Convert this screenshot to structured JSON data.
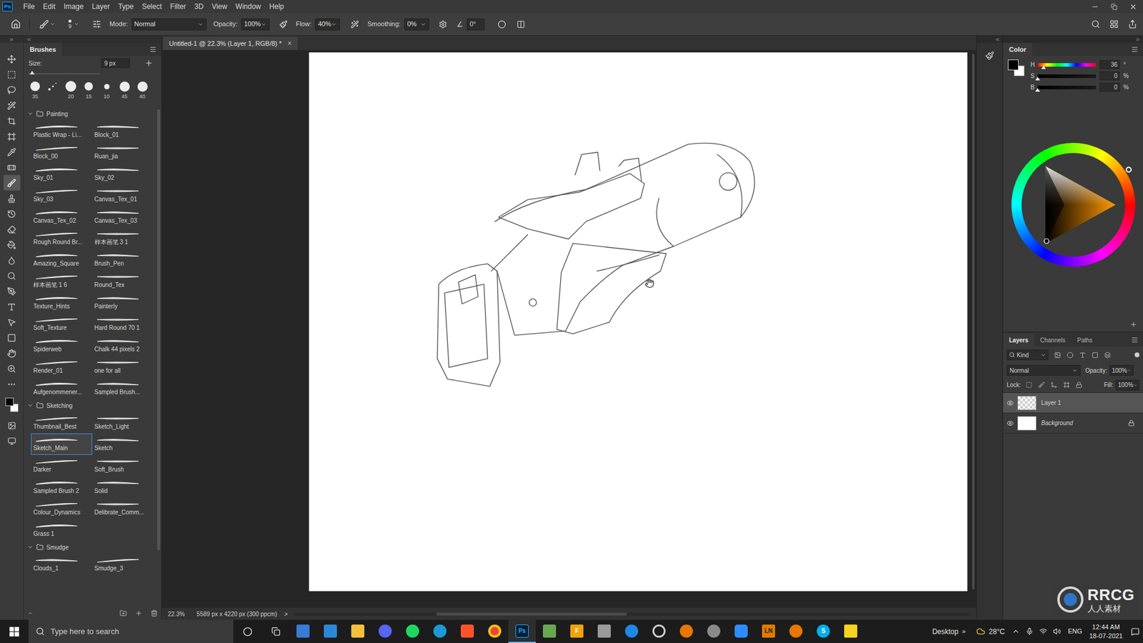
{
  "menu_bar": {
    "app_icon": "Ps",
    "items": [
      "File",
      "Edit",
      "Image",
      "Layer",
      "Type",
      "Select",
      "Filter",
      "3D",
      "View",
      "Window",
      "Help"
    ]
  },
  "options_bar": {
    "brush_size": "9",
    "mode_label": "Mode:",
    "mode": "Normal",
    "opacity_label": "Opacity:",
    "opacity": "100%",
    "flow_label": "Flow:",
    "flow": "40%",
    "smoothing_label": "Smoothing:",
    "smoothing": "0%",
    "angle": "0°"
  },
  "toolbar": {
    "tools": [
      {
        "kind": "move",
        "selected": false
      },
      {
        "kind": "marquee",
        "selected": false
      },
      {
        "kind": "lasso",
        "selected": false
      },
      {
        "kind": "wand",
        "selected": false
      },
      {
        "kind": "crop",
        "selected": false
      },
      {
        "kind": "frame",
        "selected": false
      },
      {
        "kind": "eyedropper",
        "selected": false
      },
      {
        "kind": "healing",
        "selected": false
      },
      {
        "kind": "brush",
        "selected": true
      },
      {
        "kind": "stamp",
        "selected": false
      },
      {
        "kind": "history",
        "selected": false
      },
      {
        "kind": "eraser",
        "selected": false
      },
      {
        "kind": "gradient",
        "selected": false
      },
      {
        "kind": "blur",
        "selected": false
      },
      {
        "kind": "dodge",
        "selected": false
      },
      {
        "kind": "pen",
        "selected": false
      },
      {
        "kind": "type",
        "selected": false
      },
      {
        "kind": "select",
        "selected": false
      },
      {
        "kind": "shape",
        "selected": false
      },
      {
        "kind": "hand",
        "selected": false
      },
      {
        "kind": "zoom",
        "selected": false
      },
      {
        "kind": "more",
        "selected": false
      }
    ],
    "foreground": "#000000",
    "background": "#ffffff"
  },
  "brushes_panel": {
    "title": "Brushes",
    "size_label": "Size:",
    "size": "9 px",
    "size_level": 0.02,
    "presets": [
      {
        "kind": "round",
        "label": "35"
      },
      {
        "kind": "scatter"
      },
      {
        "kind": "round",
        "label": "20"
      },
      {
        "kind": "round",
        "label": "15"
      },
      {
        "kind": "round",
        "label": "10"
      },
      {
        "kind": "round",
        "label": "45"
      },
      {
        "kind": "round",
        "label": "40"
      }
    ],
    "groups": [
      {
        "name": "Painting",
        "expanded": true,
        "brushes": [
          {
            "name": "Plastic Wrap - Li...",
            "selected": false
          },
          {
            "name": "Block_01",
            "selected": false
          },
          {
            "name": "Block_00",
            "selected": false
          },
          {
            "name": "Ruan_jia",
            "selected": false
          },
          {
            "name": "Sky_01",
            "selected": false
          },
          {
            "name": "Sky_02",
            "selected": false
          },
          {
            "name": "Sky_03",
            "selected": false
          },
          {
            "name": "Canvas_Tex_01",
            "selected": false
          },
          {
            "name": "Canvas_Tex_02",
            "selected": false
          },
          {
            "name": "Canvas_Tex_03",
            "selected": false
          },
          {
            "name": "Rough Round Br...",
            "selected": false
          },
          {
            "name": "样本画笔 3 1",
            "selected": false
          },
          {
            "name": "Amazing_Square",
            "selected": false
          },
          {
            "name": "Brush_Pen",
            "selected": false
          },
          {
            "name": "样本画笔 1 6",
            "selected": false
          },
          {
            "name": "Round_Tex",
            "selected": false
          },
          {
            "name": "Texture_Hints",
            "selected": false
          },
          {
            "name": "Painterly",
            "selected": false
          },
          {
            "name": "Soft_Texture",
            "selected": false
          },
          {
            "name": "Hard Round 70 1",
            "selected": false
          },
          {
            "name": "Spiderweb",
            "selected": false
          },
          {
            "name": "Chalk 44 pixels 2",
            "selected": false
          },
          {
            "name": "Render_01",
            "selected": false
          },
          {
            "name": "one for all",
            "selected": false
          },
          {
            "name": "Aufgenommener...",
            "selected": false
          },
          {
            "name": "Sampled Brush...",
            "selected": false
          }
        ]
      },
      {
        "name": "Sketching",
        "expanded": true,
        "brushes": [
          {
            "name": "Thumbnail_Best",
            "selected": false
          },
          {
            "name": "Sketch_Light",
            "selected": false
          },
          {
            "name": "Sketch_Main",
            "selected": true
          },
          {
            "name": "Sketch",
            "selected": false
          },
          {
            "name": "Darker",
            "selected": false
          },
          {
            "name": "Soft_Brush",
            "selected": false
          },
          {
            "name": "Sampled Brush 2",
            "selected": false
          },
          {
            "name": "Solid",
            "selected": false
          },
          {
            "name": "Colour_Dynamics",
            "selected": false
          },
          {
            "name": "Delibrate_Comm...",
            "selected": false
          },
          {
            "name": "Grass 1",
            "selected": false
          }
        ]
      },
      {
        "name": "Smudge",
        "expanded": true,
        "brushes": [
          {
            "name": "Clouds_1",
            "selected": false
          },
          {
            "name": "Smudge_3",
            "selected": false
          }
        ]
      }
    ]
  },
  "document": {
    "tab": "Untitled-1 @ 22.3% (Layer 1, RGB/8) *",
    "close": "×"
  },
  "status_bar": {
    "zoom": "22.3%",
    "info": "5589 px x 4220 px (300 ppcm)",
    "arrow": ">"
  },
  "color_panel": {
    "title": "Color",
    "foreground": "#000000",
    "background": "#ffffff",
    "channels": [
      {
        "label": "H",
        "value": "36",
        "unit": "°",
        "level": 0.1
      },
      {
        "label": "S",
        "value": "0",
        "unit": "%",
        "level": 0
      },
      {
        "label": "B",
        "value": "0",
        "unit": "%",
        "level": 0
      }
    ]
  },
  "layers_panel": {
    "tabs": [
      {
        "label": "Layers",
        "selected": true
      },
      {
        "label": "Channels",
        "selected": false
      },
      {
        "label": "Paths",
        "selected": false
      }
    ],
    "filter": "Kind",
    "blend_mode": "Normal",
    "opacity_label": "Opacity:",
    "opacity": "100%",
    "lock_label": "Lock:",
    "fill_label": "Fill:",
    "fill": "100%",
    "layers": [
      {
        "name": "Layer 1",
        "kind": "transparent",
        "visible": true,
        "selected": true,
        "locked": false
      },
      {
        "name": "Background",
        "kind": "white",
        "visible": true,
        "selected": false,
        "locked": true
      }
    ]
  },
  "taskbar": {
    "search_placeholder": "Type here to search",
    "desktop": "Desktop",
    "chevron": "»",
    "temperature": "28°C",
    "language": "ENG",
    "time": "12:44 AM",
    "date": "18-07-2021",
    "apps": [
      {
        "kind": "store",
        "active": false
      },
      {
        "kind": "mail",
        "active": false
      },
      {
        "kind": "folder",
        "active": false
      },
      {
        "kind": "discord",
        "active": false
      },
      {
        "kind": "spotify",
        "active": false
      },
      {
        "kind": "edge",
        "active": false
      },
      {
        "kind": "brave",
        "active": false
      },
      {
        "kind": "chrome",
        "active": false
      },
      {
        "kind": "photoshop",
        "label": "Ps",
        "active": true
      },
      {
        "kind": "green",
        "active": false
      },
      {
        "kind": "orange",
        "label": "F",
        "active": false
      },
      {
        "kind": "gray",
        "active": false
      },
      {
        "kind": "blue",
        "active": false
      },
      {
        "kind": "ring",
        "active": false
      },
      {
        "kind": "blender",
        "active": false
      },
      {
        "kind": "sphere",
        "active": false
      },
      {
        "kind": "zoom",
        "active": false
      },
      {
        "kind": "lettered",
        "label": "LN",
        "active": false
      },
      {
        "kind": "blender",
        "active": false
      },
      {
        "kind": "skype",
        "label": "S",
        "active": false
      },
      {
        "kind": "sticky",
        "active": false
      }
    ]
  },
  "watermark": {
    "text": "RRCG",
    "subtext": "人人素材"
  }
}
